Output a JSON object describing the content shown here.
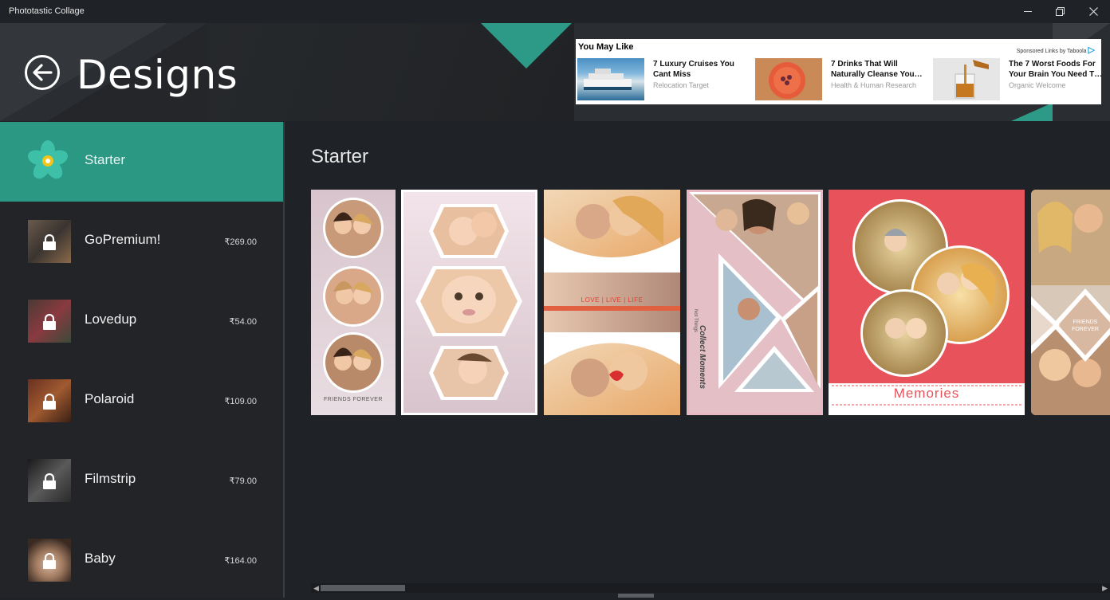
{
  "window": {
    "title": "Phototastic Collage",
    "controls": {
      "minimize_icon": "minimize-icon",
      "restore_icon": "restore-icon",
      "close_icon": "close-icon"
    }
  },
  "header": {
    "back_icon": "back-arrow-icon",
    "title": "Designs"
  },
  "ad": {
    "title": "You May Like",
    "sponsor": "Sponsored Links by Taboola",
    "items": [
      {
        "headline": "7 Luxury Cruises You Cant Miss",
        "source": "Relocation Target"
      },
      {
        "headline": "7 Drinks That Will Naturally Cleanse You…",
        "source": "Health & Human Research"
      },
      {
        "headline": "The 7 Worst Foods For Your Brain You Need T…",
        "source": "Organic Welcome"
      }
    ]
  },
  "sidebar": {
    "items": [
      {
        "label": "Starter",
        "price": "",
        "active": true,
        "locked": false
      },
      {
        "label": "GoPremium!",
        "price": "₹269.00",
        "active": false,
        "locked": true
      },
      {
        "label": "Lovedup",
        "price": "₹54.00",
        "active": false,
        "locked": true
      },
      {
        "label": "Polaroid",
        "price": "₹109.00",
        "active": false,
        "locked": true
      },
      {
        "label": "Filmstrip",
        "price": "₹79.00",
        "active": false,
        "locked": true
      },
      {
        "label": "Baby",
        "price": "₹164.00",
        "active": false,
        "locked": true
      }
    ]
  },
  "main": {
    "section_title": "Starter",
    "templates": [
      {
        "name": "friends-forever-circles",
        "caption": "FRIENDS  FOREVER"
      },
      {
        "name": "baby-hexagons",
        "caption": ""
      },
      {
        "name": "love-live-life",
        "caption": "LOVE   |   LIVE   |   LIFE"
      },
      {
        "name": "collect-moments",
        "caption": "Collect Moments",
        "subcaption": "Not Things"
      },
      {
        "name": "memories-circles",
        "caption": "Memories"
      },
      {
        "name": "friends-forever-diamond",
        "caption": "FRIENDS FOREVER"
      }
    ]
  },
  "colors": {
    "accent": "#2a9883",
    "background": "#1f2226",
    "header": "#2a2d31",
    "memories_red": "#e8525a"
  }
}
